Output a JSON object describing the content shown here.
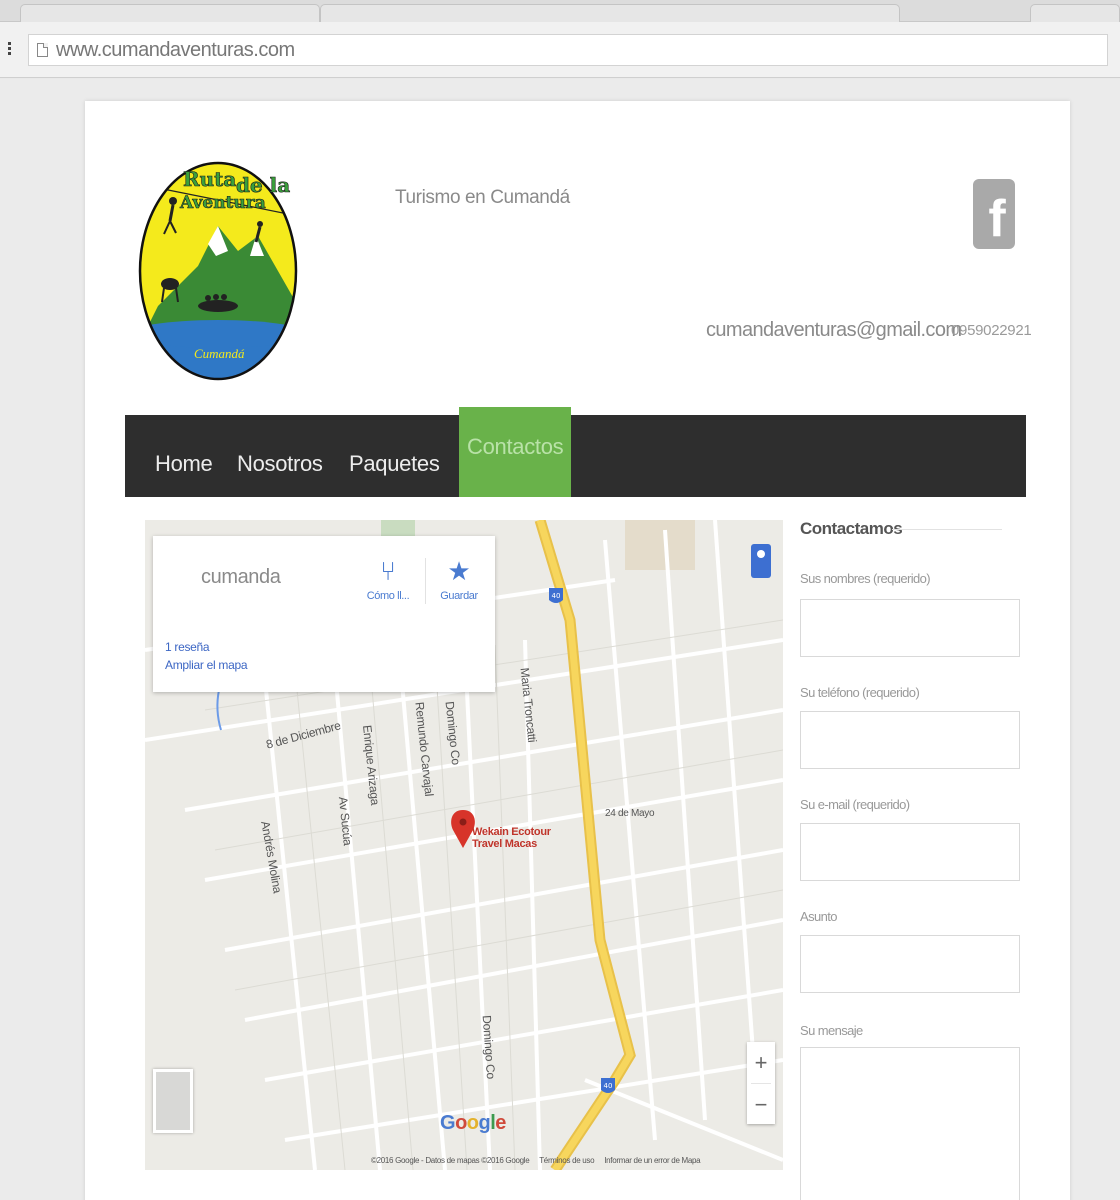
{
  "browser": {
    "url": "www.cumandaventuras.com"
  },
  "header": {
    "logo": {
      "top_text": "Ruta de la Aventura",
      "bottom_text": "Cumandá"
    },
    "tagline": "Turismo en Cumandá",
    "social_icon": "facebook-icon",
    "email": "cumandaventuras@gmail.com",
    "phone": "0959022921"
  },
  "nav": {
    "items": [
      {
        "label": "Home",
        "active": false
      },
      {
        "label": "Nosotros",
        "active": false
      },
      {
        "label": "Paquetes",
        "active": false
      },
      {
        "label": "Contactos",
        "active": true
      }
    ],
    "colors": {
      "bar": "#2e2e2e",
      "active": "#69b24a"
    }
  },
  "map": {
    "place": "cumanda",
    "directions_label": "Cómo ll...",
    "save_label": "Guardar",
    "reviews_link": "1 reseña",
    "enlarge_link": "Ampliar el mapa",
    "pin_label": "Wekain Ecotour Travel Macas",
    "route_badge": "40",
    "streets": [
      "8 de Diciembre",
      "Enrique Arizaga",
      "Remundo Carvajal",
      "Domingo Co",
      "Maria Troncatti",
      "Av Sucúa",
      "Andrés Molina",
      "Domingo Co",
      "24 de Mayo"
    ],
    "logo": "Google",
    "footer": [
      "©2016 Google - Datos de mapas ©2016 Google",
      "Términos de uso",
      "Informar de un error de Mapa"
    ]
  },
  "form": {
    "title": "Contactamos",
    "fields": [
      {
        "label": "Sus nombres (requerido)",
        "value": ""
      },
      {
        "label": "Su teléfono (requerido)",
        "value": ""
      },
      {
        "label": "Su e-mail (requerido)",
        "value": ""
      },
      {
        "label": "Asunto",
        "value": ""
      },
      {
        "label": "Su mensaje",
        "value": ""
      }
    ]
  }
}
